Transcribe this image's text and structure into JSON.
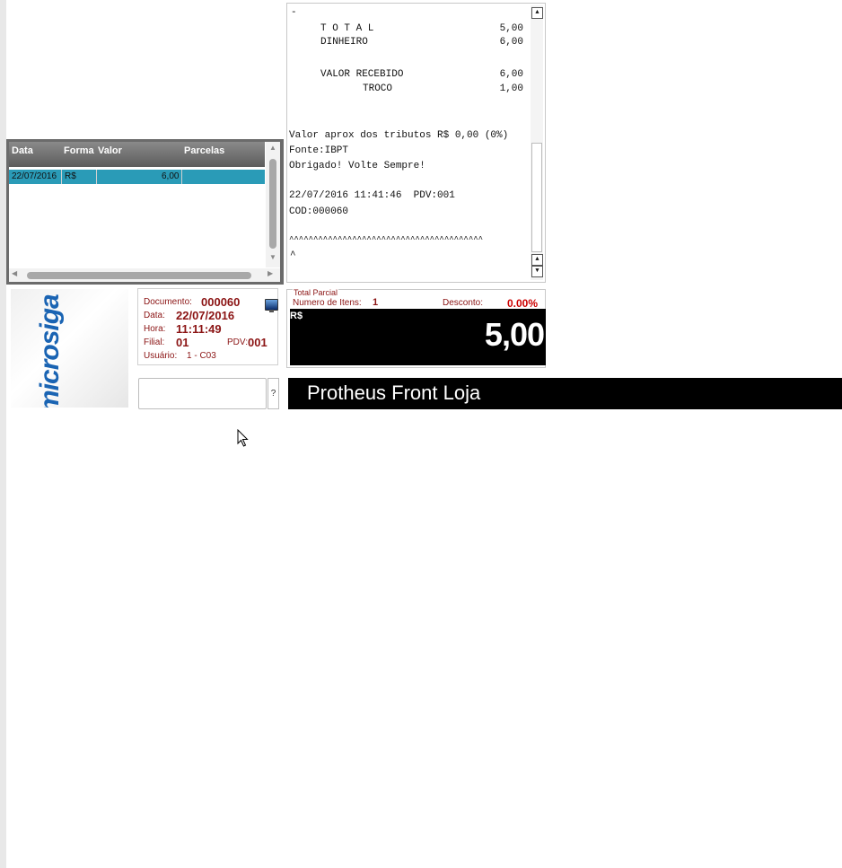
{
  "payments": {
    "headers": [
      "Data",
      "Forma",
      "Valor",
      "Parcelas"
    ],
    "rows": [
      {
        "data": "22/07/2016",
        "forma": "R$",
        "valor": "6,00",
        "parcelas": ""
      }
    ]
  },
  "receipt": {
    "lines": {
      "dash": "-",
      "total_label": "T O T A L",
      "total_value": "5,00",
      "dinheiro_label": "DINHEIRO",
      "dinheiro_value": "6,00",
      "recebido_label": "VALOR RECEBIDO",
      "recebido_value": "6,00",
      "troco_label": "TROCO",
      "troco_value": "1,00",
      "tributos": "Valor aprox dos tributos R$ 0,00 (0%)",
      "fonte": "Fonte:IBPT",
      "obrigado": "Obrigado! Volte Sempre!",
      "datetime_pdv": "22/07/2016 11:41:46  PDV:001",
      "cod": "COD:000060",
      "carets": "^^^^^^^^^^^^^^^^^^^^^^^^^^^^^^^^^^^^^^^^",
      "caret": "^"
    }
  },
  "logo": {
    "text": "microsiga"
  },
  "document": {
    "documento_label": "Documento:",
    "documento_value": "000060",
    "data_label": "Data:",
    "data_value": "22/07/2016",
    "hora_label": "Hora:",
    "hora_value": "11:11:49",
    "filial_label": "Filial:",
    "filial_value": "01",
    "pdv_label": "PDV:",
    "pdv_value": "001",
    "usuario_label": "Usuário:",
    "usuario_value": "1 - C03"
  },
  "total": {
    "legend": "Total Parcial",
    "items_label": "Numero de Itens:",
    "items_value": "1",
    "discount_label": "Desconto:",
    "discount_value": "0.00%",
    "currency": "R$",
    "amount": "5,00"
  },
  "help_label": "?",
  "banner": {
    "title": "Protheus Front Loja"
  },
  "colors": {
    "accent_row": "#2a9bb7",
    "label_red": "#8b1414",
    "logo_blue": "#1a64b3"
  }
}
